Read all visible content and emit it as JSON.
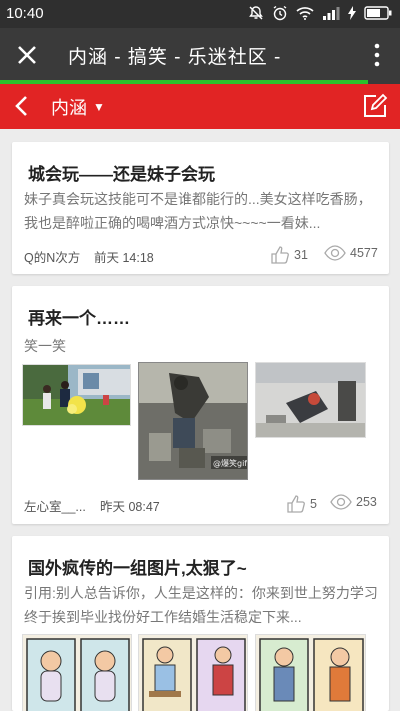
{
  "status_bar": {
    "time": "10:40"
  },
  "header": {
    "title": "内涵 - 搞笑 - 乐迷社区 -",
    "progress": 0.92
  },
  "nav": {
    "title": "内涵"
  },
  "posts": [
    {
      "title": "城会玩——还是妹子会玩",
      "body": "妹子真会玩这技能可不是谁都能行的...美女这样吃香肠，我也是醉啦正确的喝啤酒方式凉快~~~~一看妹...",
      "author": "Q的N次方",
      "time": "前天 14:18",
      "likes": "31",
      "views": "4577"
    },
    {
      "title": "再来一个……",
      "subtitle": "笑一笑",
      "author": "左心室__...",
      "time": "昨天 08:47",
      "likes": "5",
      "views": "253",
      "watermark": "@爆笑gif图"
    },
    {
      "title": "国外疯传的一组图片,太狠了~",
      "body": "引用:别人总告诉你，人生是这样的：你来到世上努力学习终于挨到毕业找份好工作结婚生活稳定下来..."
    }
  ],
  "colors": {
    "nav_red": "#e12424",
    "title_bar": "#3a3a3a",
    "progress_green": "#2bc12b"
  }
}
